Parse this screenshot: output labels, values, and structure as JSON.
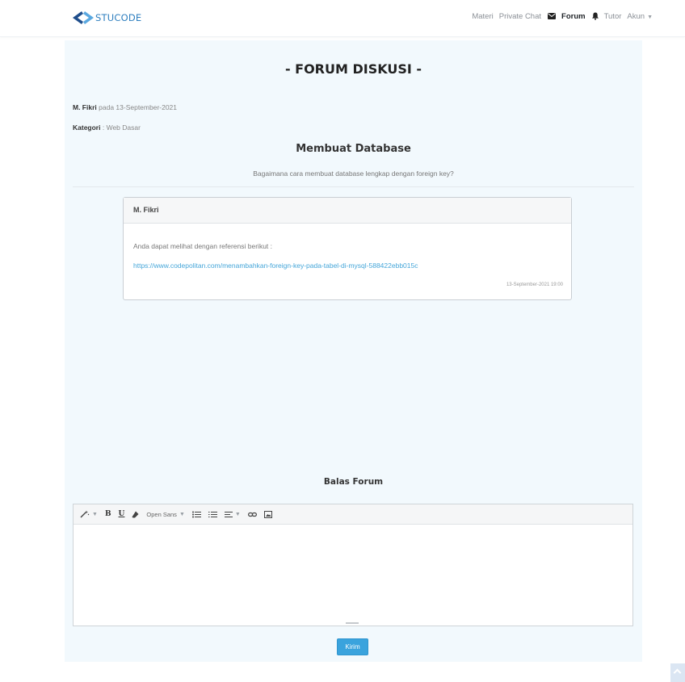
{
  "brand": {
    "name": "STUCODE"
  },
  "nav": {
    "items": [
      {
        "label": "Materi"
      },
      {
        "label": "Private Chat"
      },
      {
        "label": "Forum"
      },
      {
        "label": "Tutor"
      },
      {
        "label": "Akun"
      }
    ]
  },
  "forum": {
    "heading": "- FORUM DISKUSI -",
    "author": "M. Fikri",
    "date_text": "pada 13-September-2021",
    "category_label": "Kategori",
    "category_value": ": Web Dasar",
    "thread_title": "Membuat Database",
    "thread_body": "Bagaimana cara membuat database lengkap dengan foreign key?"
  },
  "reply": {
    "author": "M. Fikri",
    "text": "Anda dapat melihat dengan referensi berikut :",
    "link": "https://www.codepolitan.com/menambahkan-foreign-key-pada-tabel-di-mysql-588422ebb015c",
    "timestamp": "13-September-2021 19:00"
  },
  "reply_form": {
    "title": "Balas Forum",
    "font_select": "Open Sans",
    "submit_label": "Kirim"
  },
  "colors": {
    "accent": "#3aa3dd",
    "panel": "#f2f9fd",
    "link": "#45a6d9"
  }
}
